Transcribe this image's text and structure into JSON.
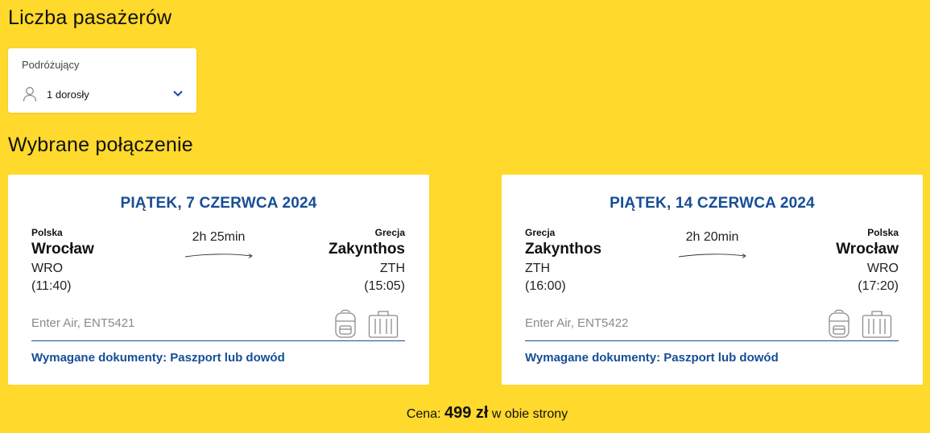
{
  "passengers_section": {
    "title": "Liczba pasażerów",
    "label": "Podróżujący",
    "value": "1 dorosły"
  },
  "selected_section": {
    "title": "Wybrane połączenie"
  },
  "flights": [
    {
      "date": "PIĄTEK, 7 CZERWCA 2024",
      "from_country": "Polska",
      "from_city": "Wrocław",
      "from_code": "WRO",
      "from_time": "(11:40)",
      "to_country": "Grecja",
      "to_city": "Zakynthos",
      "to_code": "ZTH",
      "to_time": "(15:05)",
      "duration": "2h 25min",
      "airline": "Enter Air, ENT5421",
      "documents": "Wymagane dokumenty: Paszport lub dowód"
    },
    {
      "date": "PIĄTEK, 14 CZERWCA 2024",
      "from_country": "Grecja",
      "from_city": "Zakynthos",
      "from_code": "ZTH",
      "from_time": "(16:00)",
      "to_country": "Polska",
      "to_city": "Wrocław",
      "to_code": "WRO",
      "to_time": "(17:20)",
      "duration": "2h 20min",
      "airline": "Enter Air, ENT5422",
      "documents": "Wymagane dokumenty: Paszport lub dowód"
    }
  ],
  "price": {
    "label": "Cena:",
    "amount": "499 zł",
    "suffix": "w obie strony"
  },
  "icons": {
    "passenger": "user-icon",
    "dropdown": "chevron-down-icon",
    "hand_luggage": "backpack-icon",
    "checked_luggage": "suitcase-icon",
    "flight_direction": "arrow-right-icon"
  },
  "colors": {
    "background": "#FFD92B",
    "accent": "#164E96"
  }
}
